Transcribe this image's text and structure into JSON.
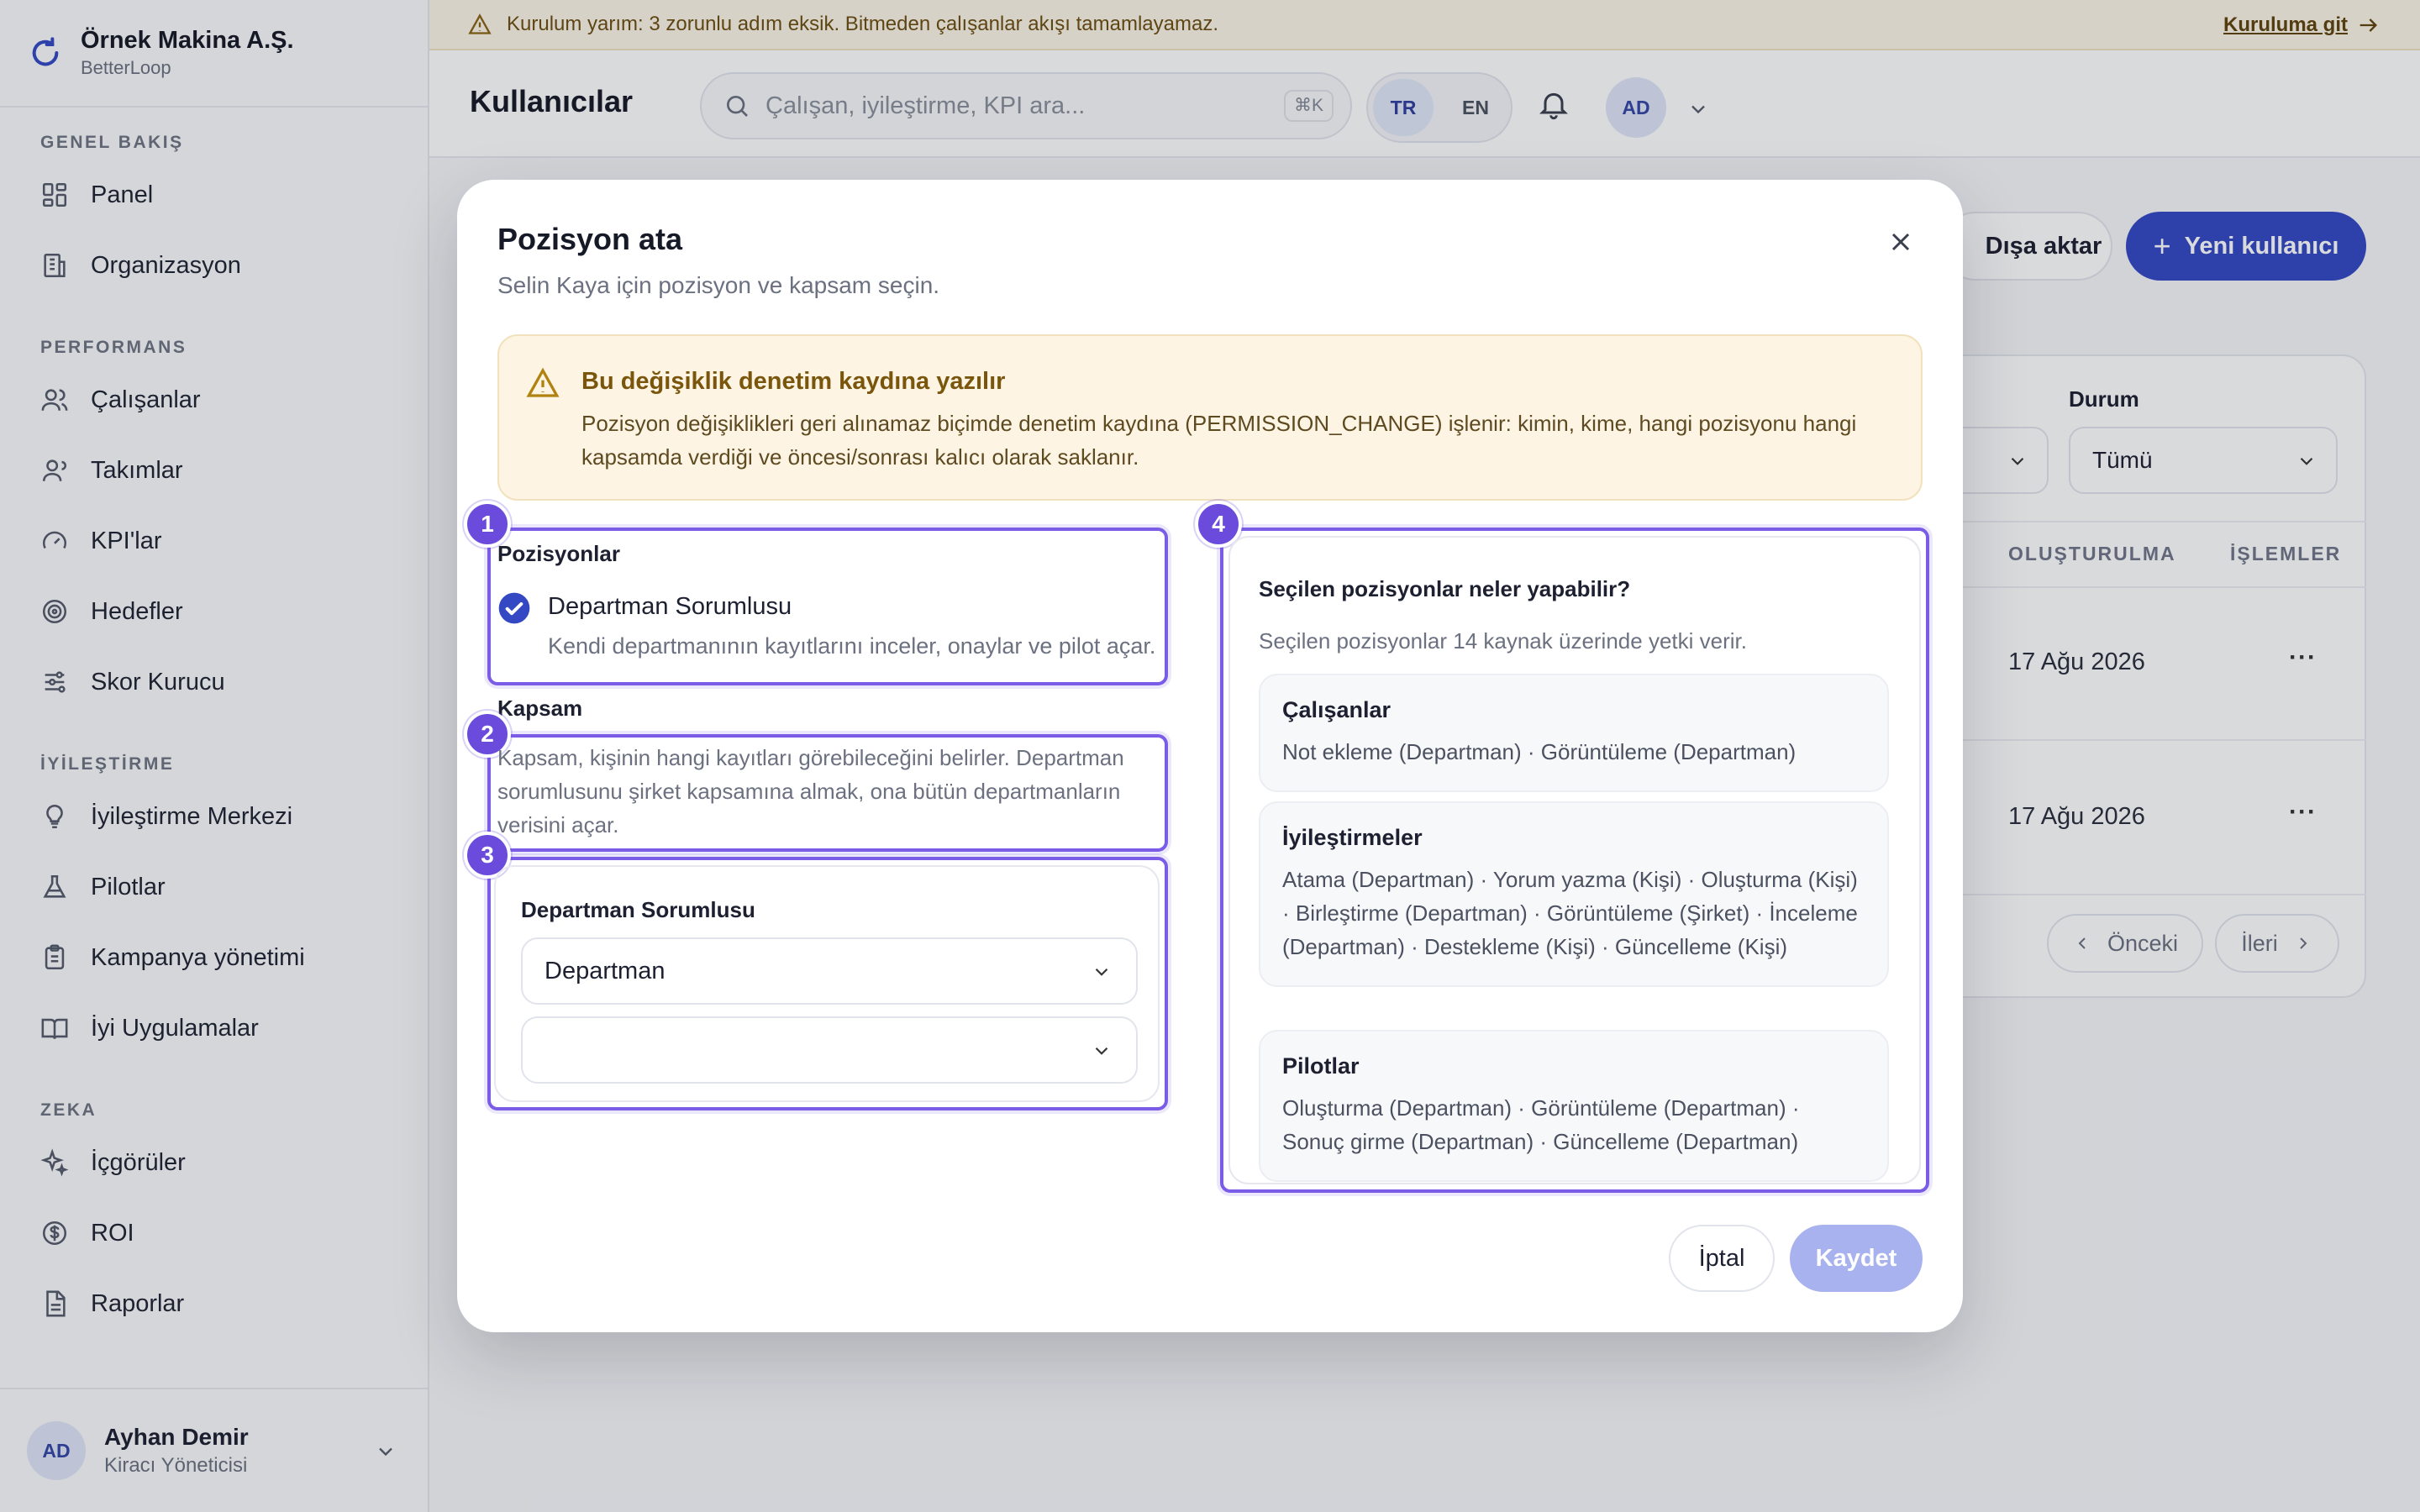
{
  "brand": {
    "name": "Örnek Makina A.Ş.",
    "product": "BetterLoop"
  },
  "sidebar": {
    "sections": [
      {
        "title": "GENEL BAKIŞ",
        "items": [
          {
            "label": "Panel",
            "icon": "grid-icon"
          },
          {
            "label": "Organizasyon",
            "icon": "building-icon"
          }
        ]
      },
      {
        "title": "PERFORMANS",
        "items": [
          {
            "label": "Çalışanlar",
            "icon": "users-icon"
          },
          {
            "label": "Takımlar",
            "icon": "team-icon"
          },
          {
            "label": "KPI'lar",
            "icon": "gauge-icon"
          },
          {
            "label": "Hedefler",
            "icon": "target-icon"
          },
          {
            "label": "Skor Kurucu",
            "icon": "sliders-icon"
          }
        ]
      },
      {
        "title": "İYİLEŞTİRME",
        "items": [
          {
            "label": "İyileştirme Merkezi",
            "icon": "lightbulb-icon"
          },
          {
            "label": "Pilotlar",
            "icon": "flask-icon"
          },
          {
            "label": "Kampanya yönetimi",
            "icon": "clipboard-icon"
          },
          {
            "label": "İyi Uygulamalar",
            "icon": "book-icon"
          }
        ]
      },
      {
        "title": "ZEKA",
        "items": [
          {
            "label": "İçgörüler",
            "icon": "sparkles-icon"
          },
          {
            "label": "ROI",
            "icon": "dollar-icon"
          },
          {
            "label": "Raporlar",
            "icon": "file-icon"
          }
        ]
      }
    ],
    "user": {
      "initials": "AD",
      "name": "Ayhan Demir",
      "role": "Kiracı Yöneticisi"
    }
  },
  "banner": {
    "text": "Kurulum yarım: 3 zorunlu adım eksik. Bitmeden çalışanlar akışı tamamlayamaz.",
    "link": "Kuruluma git"
  },
  "header": {
    "title": "Kullanıcılar",
    "search_placeholder": "Çalışan, iyileştirme, KPI ara...",
    "shortcut": "⌘K",
    "lang_tr": "TR",
    "lang_en": "EN",
    "avatar": "AD"
  },
  "background": {
    "export_label": "Dışa aktar",
    "new_user_label": "Yeni kullanıcı",
    "filter_status_label": "Durum",
    "filter_status_value": "Tümü",
    "col_created": "OLUŞTURULMA",
    "col_actions": "İŞLEMLER",
    "rows": [
      {
        "created": "17 Ağu 2026"
      },
      {
        "created": "17 Ağu 2026"
      }
    ],
    "prev": "Önceki",
    "next": "İleri"
  },
  "modal": {
    "title": "Pozisyon ata",
    "subtitle": "Selin Kaya için pozisyon ve kapsam seçin.",
    "warning_title": "Bu değişiklik denetim kaydına yazılır",
    "warning_body": "Pozisyon değişiklikleri geri alınamaz biçimde denetim kaydına (PERMISSION_CHANGE) işlenir: kimin, kime, hangi pozisyonu hangi kapsamda verdiği ve öncesi/sonrası kalıcı olarak saklanır.",
    "positions_label": "Pozisyonlar",
    "position_name": "Departman Sorumlusu",
    "position_desc": "Kendi departmanının kayıtlarını inceler, onaylar ve pilot açar.",
    "scope_label": "Kapsam",
    "scope_desc": "Kapsam, kişinin hangi kayıtları görebileceğini belirler. Departman sorumlusunu şirket kapsamına almak, ona bütün departmanların verisini açar.",
    "role_card_title": "Departman Sorumlusu",
    "scope_select_value": "Departman",
    "scope_detail_value": "",
    "perm_heading": "Seçilen pozisyonlar neler yapabilir?",
    "perm_summary": "Seçilen pozisyonlar 14 kaynak üzerinde yetki verir.",
    "perm_items": [
      {
        "title": "Çalışanlar",
        "body": "Not ekleme (Departman) · Görüntüleme (Departman)"
      },
      {
        "title": "İyileştirmeler",
        "body": "Atama (Departman) · Yorum yazma (Kişi) · Oluşturma (Kişi) · Birleştirme (Departman) · Görüntüleme (Şirket) · İnceleme (Departman) · Destekleme (Kişi) · Güncelleme (Kişi)"
      },
      {
        "title": "Pilotlar",
        "body": "Oluşturma (Departman) · Görüntüleme (Departman) · Sonuç girme (Departman) · Güncelleme (Departman)"
      }
    ],
    "cancel": "İptal",
    "save": "Kaydet",
    "badges": [
      "1",
      "2",
      "3",
      "4"
    ]
  },
  "colors": {
    "accent": "#3448c4",
    "highlight": "#7a5ce6",
    "warning_bg": "#fdf4e3"
  }
}
